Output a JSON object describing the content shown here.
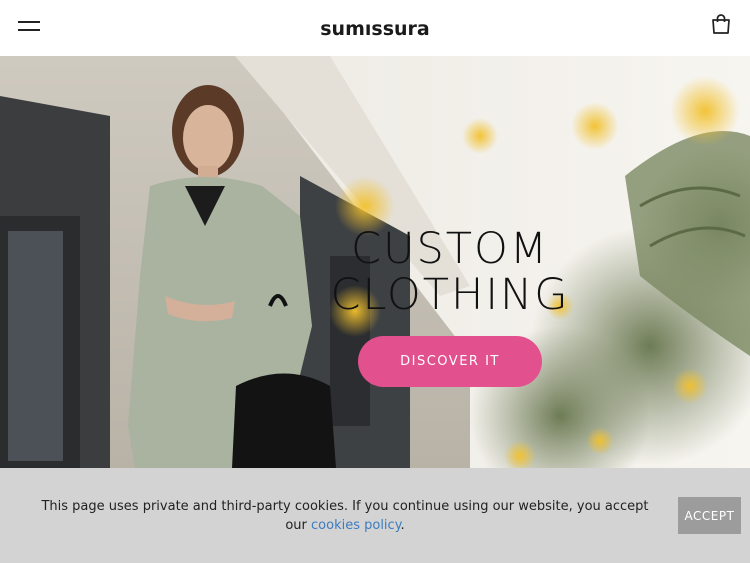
{
  "header": {
    "logo": "sumıssura",
    "menu_icon": "hamburger-menu-icon",
    "cart_icon": "shopping-bag-icon"
  },
  "hero": {
    "title_line1": "CUSTOM",
    "title_line2": "CLOTHING",
    "cta_label": "DISCOVER IT",
    "cta_color": "#e2508e"
  },
  "cookie_bar": {
    "text": "This page uses private and third-party cookies. If you continue using our website, you accept our",
    "link_text": "cookies policy",
    "text_suffix": ".",
    "accept_label": "ACCEPT",
    "link_color": "#3c7cc0"
  }
}
